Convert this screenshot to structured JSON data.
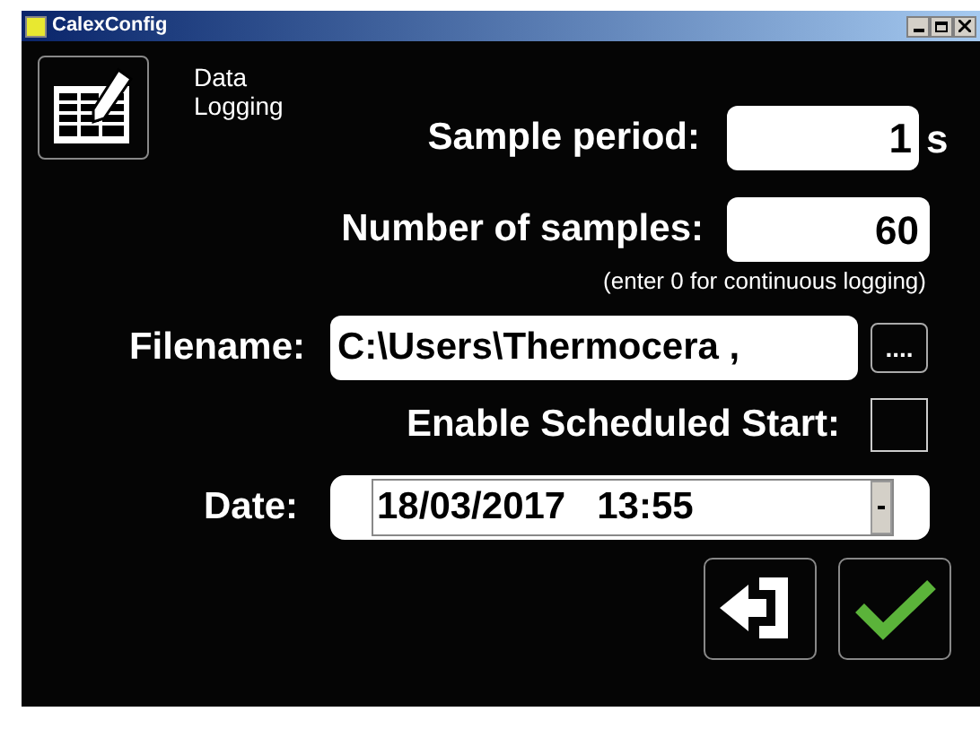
{
  "window": {
    "title": "CalexConfig"
  },
  "header": {
    "title": "Data Logging"
  },
  "sample_period": {
    "label": "Sample period:",
    "value": "1",
    "unit": "s"
  },
  "number_of_samples": {
    "label": "Number of samples:",
    "value": "60",
    "hint": "(enter 0 for continuous logging)"
  },
  "filename": {
    "label": "Filename:",
    "value": "C:\\Users\\Thermocera ,",
    "browse": "...."
  },
  "scheduled_start": {
    "label": "Enable Scheduled Start:",
    "checked": false
  },
  "date": {
    "label": "Date:",
    "value": "18/03/2017   13:55"
  }
}
